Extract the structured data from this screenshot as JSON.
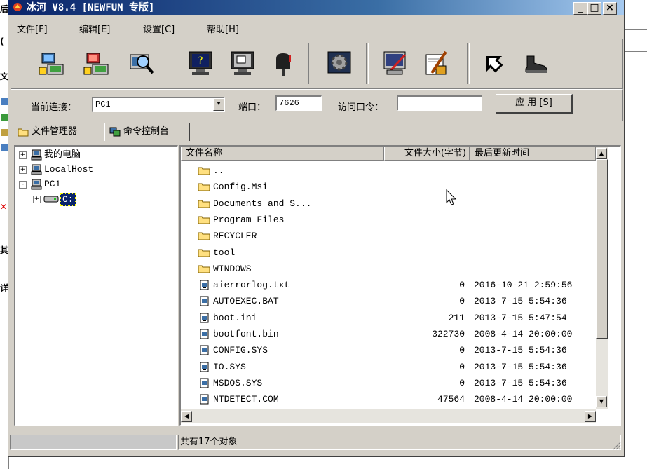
{
  "window": {
    "title": "冰河 V8.4 [NEWFUN 专版]",
    "controls": [
      "_",
      "□",
      "×"
    ]
  },
  "menu": [
    {
      "label": "文件[F]"
    },
    {
      "label": "编辑[E]"
    },
    {
      "label": "设置[C]"
    },
    {
      "label": "帮助[H]"
    }
  ],
  "toolbar_icons": [
    "add-computer-icon",
    "delete-computer-icon",
    "search-computer-icon",
    "screen-help-icon",
    "screen-capture-icon",
    "mailbox-icon",
    "config-gear-icon",
    "monitor-tool-icon",
    "build-tool-icon",
    "home-arrow-icon",
    "exit-shoe-icon"
  ],
  "connection": {
    "current_label": "当前连接：",
    "current_value": "PC1",
    "port_label": "端口：",
    "port_value": "7626",
    "password_label": "访问口令：",
    "password_value": "",
    "apply_label": "应 用 [S]"
  },
  "tabs": [
    {
      "label": "文件管理器",
      "icon": "folder-icon",
      "active": true
    },
    {
      "label": "命令控制台",
      "icon": "console-icon",
      "active": false
    }
  ],
  "tree": [
    {
      "label": "我的电脑",
      "expander": "+"
    },
    {
      "label": "LocalHost",
      "expander": "+"
    },
    {
      "label": "PC1",
      "expander": "-"
    },
    {
      "label": "C:",
      "expander": "+"
    }
  ],
  "columns": {
    "name": "文件名称",
    "size": "文件大小(字节)",
    "time": "最后更新时间"
  },
  "files": [
    {
      "name": "..",
      "type": "folder",
      "size": "",
      "time": ""
    },
    {
      "name": "Config.Msi",
      "type": "folder",
      "size": "",
      "time": ""
    },
    {
      "name": "Documents and S...",
      "type": "folder",
      "size": "",
      "time": ""
    },
    {
      "name": "Program Files",
      "type": "folder",
      "size": "",
      "time": ""
    },
    {
      "name": "RECYCLER",
      "type": "folder",
      "size": "",
      "time": ""
    },
    {
      "name": "tool",
      "type": "folder",
      "size": "",
      "time": ""
    },
    {
      "name": "WINDOWS",
      "type": "folder",
      "size": "",
      "time": ""
    },
    {
      "name": "aierrorlog.txt",
      "type": "file",
      "size": "0",
      "time": "2016-10-21 2:59:56"
    },
    {
      "name": "AUTOEXEC.BAT",
      "type": "file",
      "size": "0",
      "time": "2013-7-15 5:54:36"
    },
    {
      "name": "boot.ini",
      "type": "file",
      "size": "211",
      "time": "2013-7-15 5:47:54"
    },
    {
      "name": "bootfont.bin",
      "type": "file",
      "size": "322730",
      "time": "2008-4-14 20:00:00"
    },
    {
      "name": "CONFIG.SYS",
      "type": "file",
      "size": "0",
      "time": "2013-7-15 5:54:36"
    },
    {
      "name": "IO.SYS",
      "type": "file",
      "size": "0",
      "time": "2013-7-15 5:54:36"
    },
    {
      "name": "MSDOS.SYS",
      "type": "file",
      "size": "0",
      "time": "2013-7-15 5:54:36"
    },
    {
      "name": "NTDETECT.COM",
      "type": "file",
      "size": "47564",
      "time": "2008-4-14 20:00:00"
    }
  ],
  "status": {
    "count_text": "共有17个对象"
  },
  "background_app": {
    "left_chars": [
      "后",
      "(",
      "文",
      "其",
      "详"
    ]
  }
}
